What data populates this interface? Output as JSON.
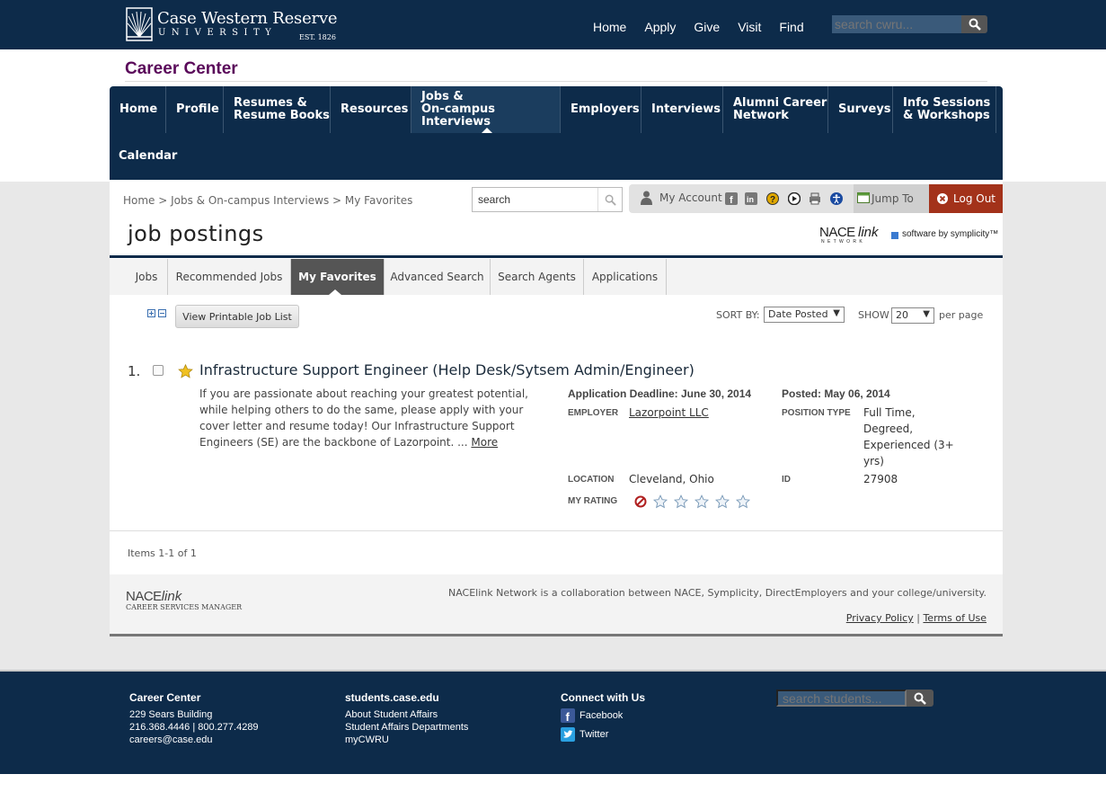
{
  "university": {
    "name": "Case Western Reserve",
    "sub": "UNIVERSITY",
    "est": "EST. 1826"
  },
  "top_links": [
    "Home",
    "Apply",
    "Give",
    "Visit",
    "Find"
  ],
  "top_search": {
    "placeholder": "search cwru..."
  },
  "career_center_title": "Career Center",
  "main_nav": [
    {
      "label": "Home"
    },
    {
      "label": "Profile"
    },
    {
      "label": "Resumes &\nResume Books"
    },
    {
      "label": "Resources"
    },
    {
      "label": "Jobs &\nOn-campus Interviews",
      "active": true
    },
    {
      "label": "Employers"
    },
    {
      "label": "Interviews"
    },
    {
      "label": "Alumni Career\nNetwork"
    },
    {
      "label": "Surveys"
    },
    {
      "label": "Info Sessions\n& Workshops"
    },
    {
      "label": "Calendar"
    }
  ],
  "breadcrumb": "Home > Jobs & On-campus Interviews > My Favorites",
  "content_search": {
    "value": "search"
  },
  "toolbar": {
    "my_account": "My Account",
    "jump_to": "Jump To",
    "log_out": "Log Out"
  },
  "page_title": "job postings",
  "vendor": {
    "nace": "NACE",
    "link": "link",
    "network": "N E T W O R K",
    "symplicity": "software by symplicity™"
  },
  "sub_tabs": [
    "Jobs",
    "Recommended Jobs",
    "My Favorites",
    "Advanced Search",
    "Search Agents",
    "Applications"
  ],
  "active_sub_tab": "My Favorites",
  "list_controls": {
    "print_button": "View Printable Job List",
    "sort_by_label": "SORT BY:",
    "sort_by_value": "Date Posted",
    "show_label": "SHOW",
    "show_value": "20",
    "per_page": "per page"
  },
  "job": {
    "number": "1.",
    "title": "Infrastructure Support Engineer (Help Desk/Sytsem Admin/Engineer)",
    "description": "If you are passionate about reaching your greatest potential, while helping others to do the same, please apply with your cover letter and resume today! Our Infrastructure Support Engineers (SE) are the backbone of Lazorpoint. ...",
    "more": "More",
    "deadline": "Application Deadline: June 30, 2014",
    "posted": "Posted: May 06, 2014",
    "employer_label": "EMPLOYER",
    "employer": "Lazorpoint LLC",
    "position_type_label": "POSITION TYPE",
    "position_type": "Full Time, Degreed, Experienced (3+ yrs)",
    "location_label": "LOCATION",
    "location": "Cleveland, Ohio",
    "id_label": "ID",
    "id": "27908",
    "rating_label": "MY RATING",
    "rating": 0
  },
  "items_summary": "Items 1-1 of 1",
  "content_footer": {
    "brand_line1": "NACE",
    "brand_line1b": "link",
    "brand_line2": "CAREER SERVICES MANAGER",
    "collab": "NACElink Network is a collaboration between NACE, Symplicity, DirectEmployers and your college/university.",
    "privacy": "Privacy Policy",
    "sep": "|",
    "terms": "Terms of Use"
  },
  "footer": {
    "col1": {
      "title": "Career Center",
      "lines": [
        "229 Sears Building",
        "216.368.4446 | 800.277.4289",
        "careers@case.edu"
      ]
    },
    "col2": {
      "title": "students.case.edu",
      "lines": [
        "About Student Affairs",
        "Student Affairs Departments",
        "myCWRU"
      ]
    },
    "col3": {
      "title": "Connect with Us",
      "facebook": "Facebook",
      "twitter": "Twitter"
    },
    "search": {
      "placeholder": "search students..."
    }
  },
  "colors": {
    "navy": "#0d2b4a",
    "purple": "#5a0a5a",
    "logout": "#a3321a"
  }
}
